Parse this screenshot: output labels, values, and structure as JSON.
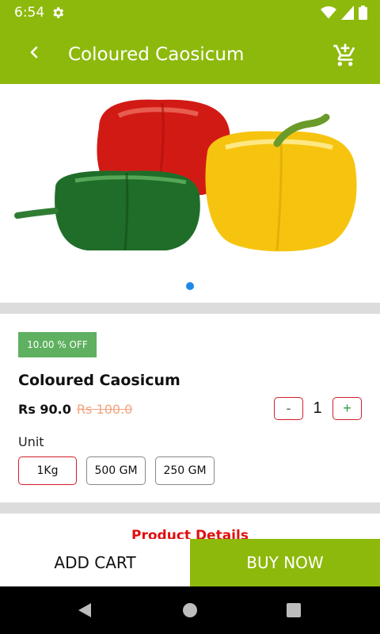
{
  "status_bar": {
    "time": "6:54",
    "icons": [
      "gear-icon",
      "wifi-icon",
      "signal-icon",
      "battery-icon"
    ]
  },
  "app_bar": {
    "title": "Coloured Caosicum",
    "back_icon": "chevron-left-icon",
    "cart_icon": "add-shopping-cart-icon"
  },
  "gallery": {
    "image": "bell-peppers-red-yellow-green",
    "active_page": 1,
    "page_count": 1
  },
  "product": {
    "discount_badge": "10.00 % OFF",
    "name": "Coloured Caosicum",
    "price": "Rs 90.0",
    "old_price": "Rs 100.0",
    "quantity": {
      "minus_label": "-",
      "value": "1",
      "plus_label": "+"
    },
    "unit_label": "Unit",
    "units": [
      {
        "label": "1Kg",
        "selected": true
      },
      {
        "label": "500 GM",
        "selected": false
      },
      {
        "label": "250 GM",
        "selected": false
      }
    ],
    "details_heading": "Product Details"
  },
  "actions": {
    "add_cart": "ADD CART",
    "buy_now": "BUY NOW"
  },
  "colors": {
    "brand_green": "#8db90c",
    "badge_green": "#5fb060",
    "accent_red": "#d21f2b",
    "old_price": "#f3a37f",
    "details_red": "#e01010"
  },
  "nav_bar": {
    "icons": [
      "back-triangle-icon",
      "home-circle-icon",
      "recents-square-icon"
    ]
  }
}
